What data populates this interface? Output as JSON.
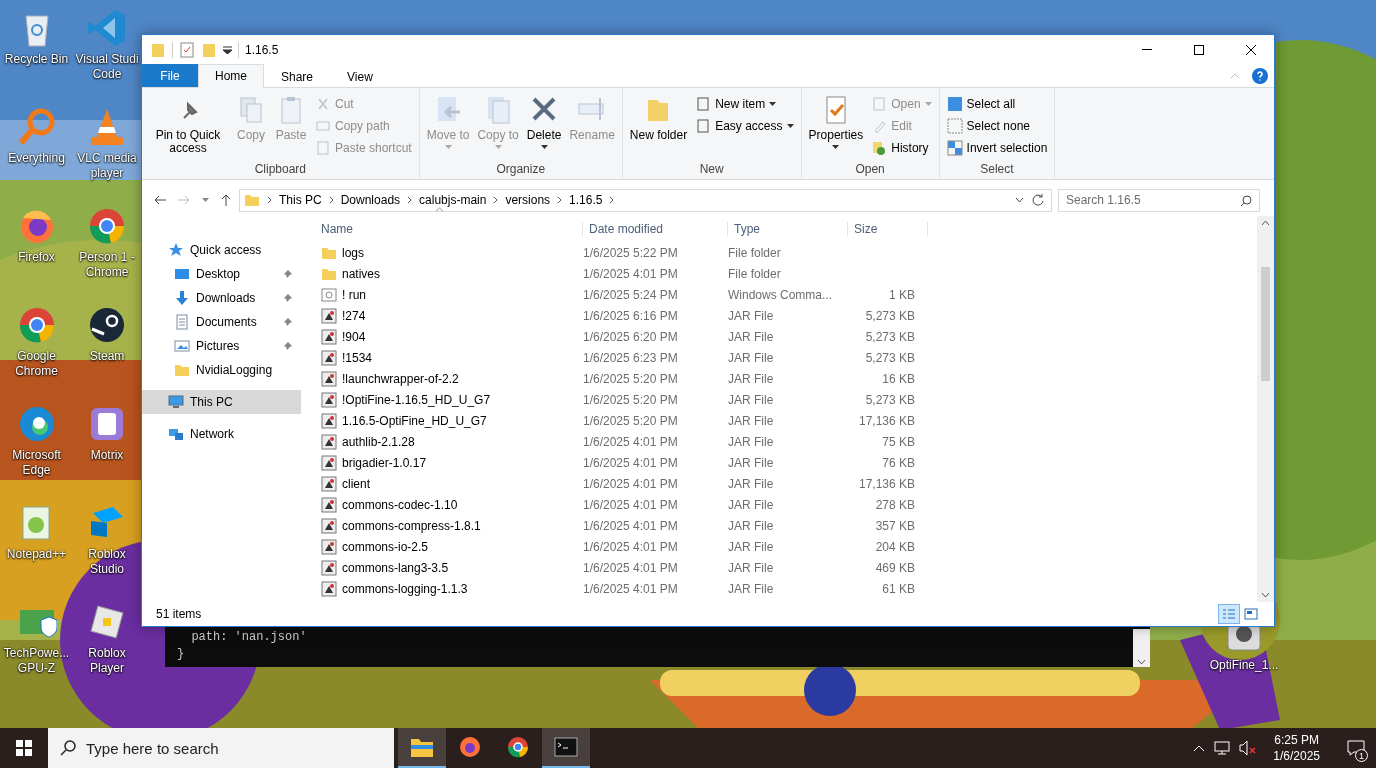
{
  "desktop_icons": [
    {
      "label": "Recycle Bin",
      "kind": "recycle"
    },
    {
      "label": "Everything",
      "kind": "everything"
    },
    {
      "label": "Firefox",
      "kind": "firefox"
    },
    {
      "label": "Google Chrome",
      "kind": "chrome"
    },
    {
      "label": "Microsoft Edge",
      "kind": "edge"
    },
    {
      "label": "Notepad++",
      "kind": "notepad"
    },
    {
      "label": "TechPowe... GPU-Z",
      "kind": "gpu"
    },
    {
      "label": "Visual Studi Code",
      "kind": "vscode"
    },
    {
      "label": "VLC media player",
      "kind": "vlc"
    },
    {
      "label": "Person 1 - Chrome",
      "kind": "chrome"
    },
    {
      "label": "Steam",
      "kind": "steam"
    },
    {
      "label": "Motrix",
      "kind": "motrix"
    },
    {
      "label": "Roblox Studio",
      "kind": "roblox"
    },
    {
      "label": "Roblox Player",
      "kind": "robloxplayer"
    }
  ],
  "desktop_file": {
    "label": "OptiFine_1..."
  },
  "terminal": {
    "lines": [
      "  path: 'nan.json'",
      "}"
    ]
  },
  "explorer": {
    "title": "1.16.5",
    "file_tab": "File",
    "tabs": [
      {
        "label": "Home",
        "selected": true
      },
      {
        "label": "Share",
        "selected": false
      },
      {
        "label": "View",
        "selected": false
      }
    ],
    "ribbon": [
      {
        "label": "Clipboard",
        "large": [
          {
            "label": "Pin to Quick access",
            "disabled": false,
            "dropdown": false
          },
          {
            "label": "Copy",
            "disabled": true,
            "dropdown": false
          },
          {
            "label": "Paste",
            "disabled": true,
            "dropdown": false
          }
        ],
        "small": [
          {
            "label": "Cut",
            "disabled": true,
            "dropdown": false
          },
          {
            "label": "Copy path",
            "disabled": true,
            "dropdown": false
          },
          {
            "label": "Paste shortcut",
            "disabled": true,
            "dropdown": false
          }
        ]
      },
      {
        "label": "Organize",
        "large": [
          {
            "label": "Move to",
            "disabled": true,
            "dropdown": true
          },
          {
            "label": "Copy to",
            "disabled": true,
            "dropdown": true
          },
          {
            "label": "Delete",
            "disabled": false,
            "dropdown": true
          },
          {
            "label": "Rename",
            "disabled": true,
            "dropdown": false
          }
        ]
      },
      {
        "label": "New",
        "large": [
          {
            "label": "New folder",
            "disabled": false,
            "dropdown": false
          }
        ],
        "small": [
          {
            "label": "New item",
            "disabled": false,
            "dropdown": true
          },
          {
            "label": "Easy access",
            "disabled": false,
            "dropdown": true
          }
        ]
      },
      {
        "label": "Open",
        "large": [
          {
            "label": "Properties",
            "disabled": false,
            "dropdown": true
          }
        ],
        "small": [
          {
            "label": "Open",
            "disabled": true,
            "dropdown": true
          },
          {
            "label": "Edit",
            "disabled": true,
            "dropdown": false
          },
          {
            "label": "History",
            "disabled": false,
            "dropdown": false
          }
        ]
      },
      {
        "label": "Select",
        "small": [
          {
            "label": "Select all",
            "disabled": false,
            "dropdown": false
          },
          {
            "label": "Select none",
            "disabled": false,
            "dropdown": false
          },
          {
            "label": "Invert selection",
            "disabled": false,
            "dropdown": false
          }
        ]
      }
    ],
    "path": [
      "This PC",
      "Downloads",
      "calubjs-main",
      "versions",
      "1.16.5"
    ],
    "search": {
      "placeholder": "Search 1.16.5"
    },
    "nav": [
      {
        "label": "Quick access",
        "kind": "star",
        "selected": false,
        "children": [
          {
            "label": "Desktop",
            "kind": "desktop",
            "selected": false,
            "pinned": true
          },
          {
            "label": "Downloads",
            "kind": "downloads",
            "selected": false,
            "pinned": true
          },
          {
            "label": "Documents",
            "kind": "documents",
            "selected": false,
            "pinned": true
          },
          {
            "label": "Pictures",
            "kind": "pictures",
            "selected": false,
            "pinned": true
          },
          {
            "label": "NvidiaLogging",
            "kind": "folder",
            "selected": false,
            "pinned": false
          }
        ]
      },
      {
        "label": "This PC",
        "kind": "pc",
        "selected": true
      },
      {
        "label": "Network",
        "kind": "network",
        "selected": false
      }
    ],
    "columns": [
      {
        "label": "Name",
        "sorted": true
      },
      {
        "label": "Date modified",
        "sorted": false
      },
      {
        "label": "Type",
        "sorted": false
      },
      {
        "label": "Size",
        "sorted": false
      }
    ],
    "rows": [
      {
        "name": "logs",
        "date": "1/6/2025 5:22 PM",
        "type": "File folder",
        "size": "",
        "kind": "folder"
      },
      {
        "name": "natives",
        "date": "1/6/2025 4:01 PM",
        "type": "File folder",
        "size": "",
        "kind": "folder"
      },
      {
        "name": "! run",
        "date": "1/6/2025 5:24 PM",
        "type": "Windows Comma...",
        "size": "1 KB",
        "kind": "cmd"
      },
      {
        "name": "!274",
        "date": "1/6/2025 6:16 PM",
        "type": "JAR File",
        "size": "5,273 KB",
        "kind": "jar"
      },
      {
        "name": "!904",
        "date": "1/6/2025 6:20 PM",
        "type": "JAR File",
        "size": "5,273 KB",
        "kind": "jar"
      },
      {
        "name": "!1534",
        "date": "1/6/2025 6:23 PM",
        "type": "JAR File",
        "size": "5,273 KB",
        "kind": "jar"
      },
      {
        "name": "!launchwrapper-of-2.2",
        "date": "1/6/2025 5:20 PM",
        "type": "JAR File",
        "size": "16 KB",
        "kind": "jar"
      },
      {
        "name": "!OptiFine-1.16.5_HD_U_G7",
        "date": "1/6/2025 5:20 PM",
        "type": "JAR File",
        "size": "5,273 KB",
        "kind": "jar"
      },
      {
        "name": "1.16.5-OptiFine_HD_U_G7",
        "date": "1/6/2025 5:20 PM",
        "type": "JAR File",
        "size": "17,136 KB",
        "kind": "jar"
      },
      {
        "name": "authlib-2.1.28",
        "date": "1/6/2025 4:01 PM",
        "type": "JAR File",
        "size": "75 KB",
        "kind": "jar"
      },
      {
        "name": "brigadier-1.0.17",
        "date": "1/6/2025 4:01 PM",
        "type": "JAR File",
        "size": "76 KB",
        "kind": "jar"
      },
      {
        "name": "client",
        "date": "1/6/2025 4:01 PM",
        "type": "JAR File",
        "size": "17,136 KB",
        "kind": "jar"
      },
      {
        "name": "commons-codec-1.10",
        "date": "1/6/2025 4:01 PM",
        "type": "JAR File",
        "size": "278 KB",
        "kind": "jar"
      },
      {
        "name": "commons-compress-1.8.1",
        "date": "1/6/2025 4:01 PM",
        "type": "JAR File",
        "size": "357 KB",
        "kind": "jar"
      },
      {
        "name": "commons-io-2.5",
        "date": "1/6/2025 4:01 PM",
        "type": "JAR File",
        "size": "204 KB",
        "kind": "jar"
      },
      {
        "name": "commons-lang3-3.5",
        "date": "1/6/2025 4:01 PM",
        "type": "JAR File",
        "size": "469 KB",
        "kind": "jar"
      },
      {
        "name": "commons-logging-1.1.3",
        "date": "1/6/2025 4:01 PM",
        "type": "JAR File",
        "size": "61 KB",
        "kind": "jar"
      }
    ],
    "status": "51 items",
    "views": [
      {
        "kind": "details",
        "selected": true
      },
      {
        "kind": "tiles",
        "selected": false
      }
    ]
  },
  "taskbar": {
    "search": {
      "placeholder": "Type here to search"
    },
    "apps": [
      {
        "kind": "explorer",
        "active": true
      },
      {
        "kind": "firefox",
        "active": false
      },
      {
        "kind": "chrome",
        "active": false
      },
      {
        "kind": "terminal",
        "active": true
      }
    ],
    "time": "6:25 PM",
    "date": "1/6/2025",
    "notifications": "1"
  }
}
